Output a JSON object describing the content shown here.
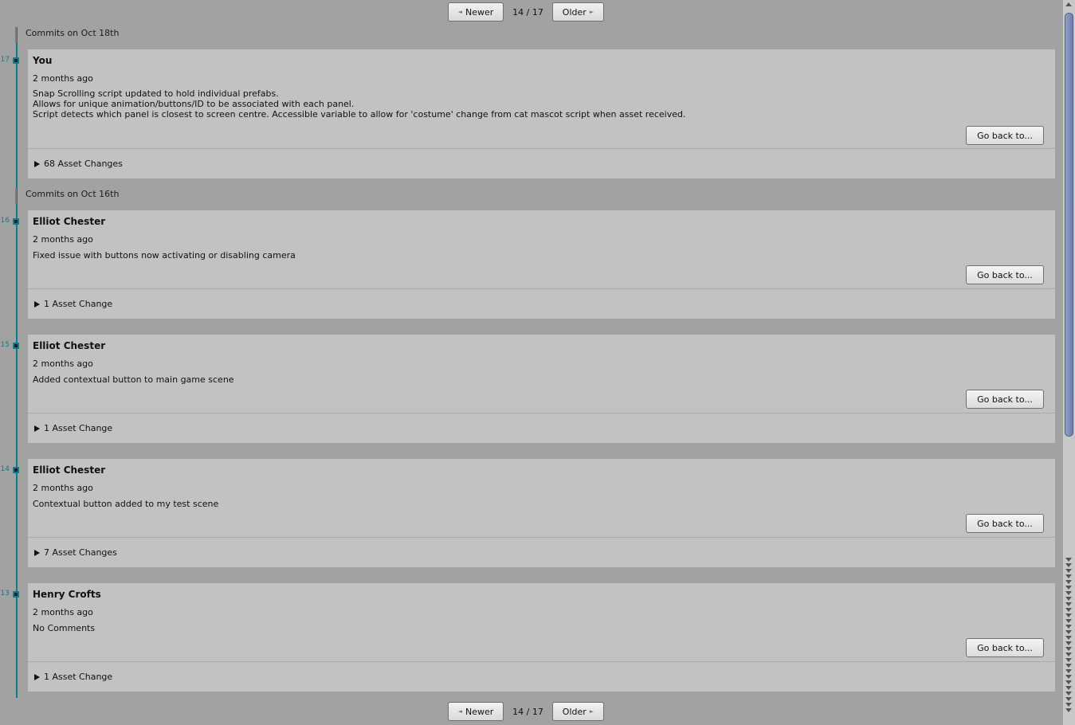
{
  "pager": {
    "newer_label": "Newer",
    "older_label": "Older",
    "page_info": "14 / 17",
    "current_page": 14,
    "total_pages": 17
  },
  "days": [
    {
      "label": "Commits on Oct 18th"
    },
    {
      "label": "Commits on Oct 16th"
    }
  ],
  "commits": [
    {
      "number": "17",
      "author": "You",
      "time": "2 months ago",
      "message": "Snap Scrolling script updated to hold individual prefabs.\nAllows for unique animation/buttons/ID to be associated with each panel.\nScript detects which panel is closest to screen centre. Accessible variable to allow for 'costume' change from cat mascot script when asset received.",
      "go_back_label": "Go back to...",
      "asset_changes": "68 Asset Changes"
    },
    {
      "number": "16",
      "author": "Elliot Chester",
      "time": "2 months ago",
      "message": "Fixed issue with buttons now activating or disabling camera",
      "go_back_label": "Go back to...",
      "asset_changes": "1 Asset Change"
    },
    {
      "number": "15",
      "author": "Elliot Chester",
      "time": "2 months ago",
      "message": "Added contextual button to main game scene",
      "go_back_label": "Go back to...",
      "asset_changes": "1 Asset Change"
    },
    {
      "number": "14",
      "author": "Elliot Chester",
      "time": "2 months ago",
      "message": "Contextual button added to my test scene",
      "go_back_label": "Go back to...",
      "asset_changes": "7 Asset Changes"
    },
    {
      "number": "13",
      "author": "Henry Crofts",
      "time": "2 months ago",
      "message": "No Comments",
      "go_back_label": "Go back to...",
      "asset_changes": "1 Asset Change"
    }
  ],
  "colors": {
    "background": "#a2a2a2",
    "card": "#c2c2c2",
    "timeline": "#0a7f8a",
    "scroll_thumb": "#7d8fbb"
  },
  "icons": {
    "newer": "arrow-left-icon",
    "older": "arrow-right-icon",
    "expand": "triangle-right-icon"
  }
}
